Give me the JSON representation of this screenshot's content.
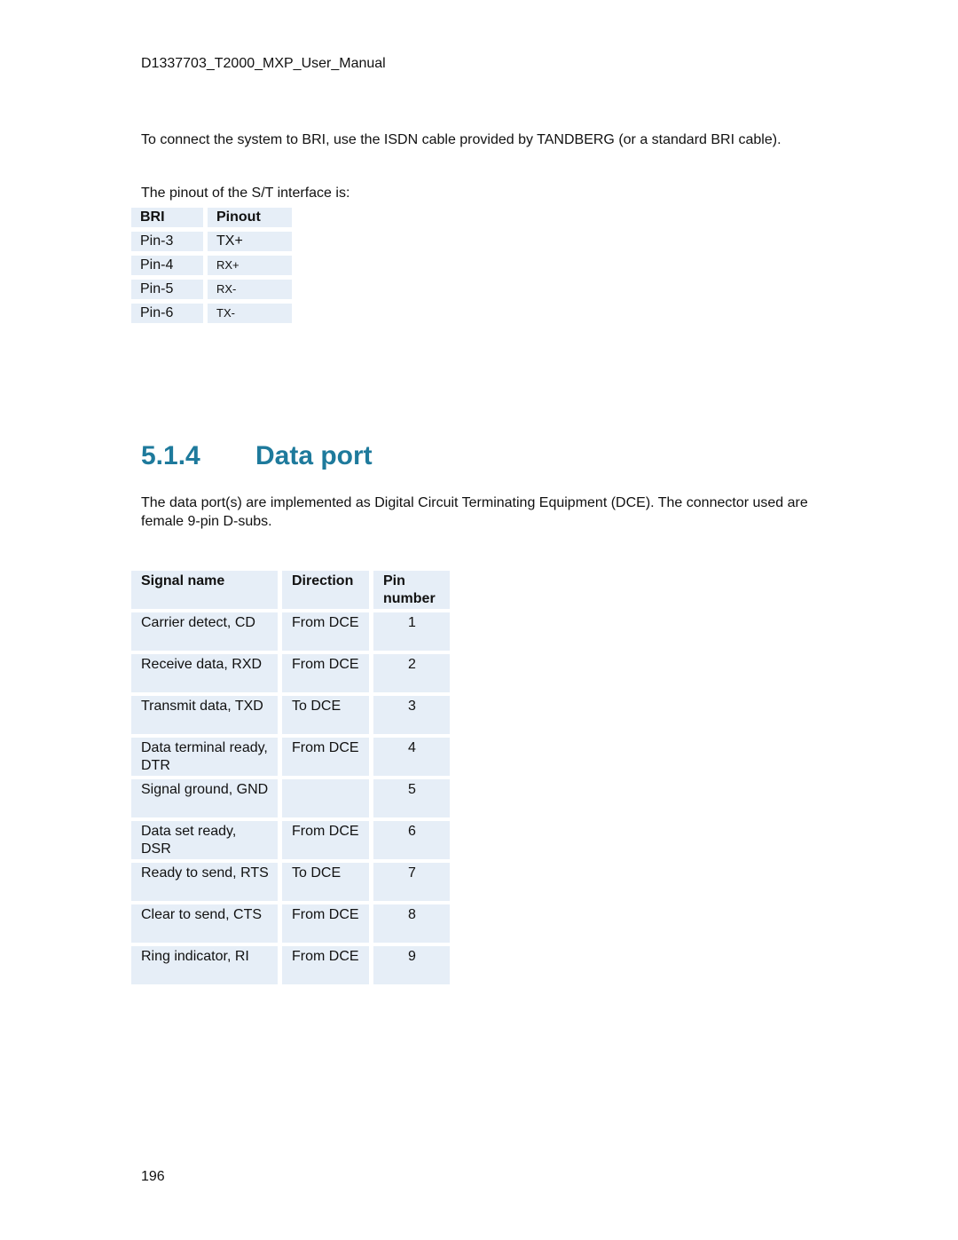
{
  "header": {
    "document_id": "D1337703_T2000_MXP_User_Manual"
  },
  "bri_section": {
    "intro": "To connect the system to BRI, use the ISDN cable provided by TANDBERG (or a standard BRI cable).",
    "pinout_intro": "The pinout of the S/T interface is:",
    "table": {
      "headers": [
        "BRI",
        "Pinout"
      ],
      "rows": [
        [
          "Pin-3",
          "TX+"
        ],
        [
          "Pin-4",
          "RX+"
        ],
        [
          "Pin-5",
          "RX-"
        ],
        [
          "Pin-6",
          "TX-"
        ]
      ]
    }
  },
  "data_port_section": {
    "number": "5.1.4",
    "title": "Data port",
    "description": "The data port(s) are implemented as Digital Circuit Terminating Equipment (DCE). The connector used are female 9-pin D-subs.",
    "table": {
      "headers": [
        "Signal name",
        "Direction",
        "Pin number"
      ],
      "rows": [
        [
          "Carrier detect, CD",
          "From DCE",
          "1"
        ],
        [
          "Receive data, RXD",
          "From DCE",
          "2"
        ],
        [
          "Transmit data, TXD",
          "To DCE",
          "3"
        ],
        [
          "Data terminal ready, DTR",
          "From DCE",
          "4"
        ],
        [
          "Signal ground, GND",
          "",
          "5"
        ],
        [
          "Data set ready, DSR",
          "From DCE",
          "6"
        ],
        [
          "Ready to send, RTS",
          "To DCE",
          "7"
        ],
        [
          "Clear to send, CTS",
          "From DCE",
          "8"
        ],
        [
          "Ring indicator, RI",
          "From DCE",
          "9"
        ]
      ]
    }
  },
  "footer": {
    "page_number": "196"
  },
  "colors": {
    "heading": "#1e7a9c",
    "table_cell_bg": "#e6eef7"
  }
}
